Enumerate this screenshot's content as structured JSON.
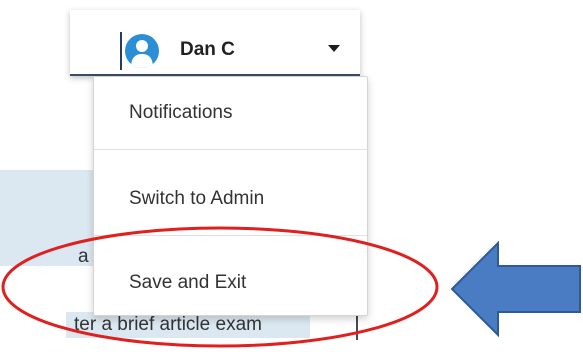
{
  "user_menu": {
    "user_name": "Dan C",
    "avatar_icon": "user-avatar-icon",
    "caret_icon": "caret-down-icon"
  },
  "dropdown": {
    "items": [
      {
        "label": "Notifications"
      },
      {
        "label": "Switch to Admin"
      },
      {
        "label": "Save and Exit"
      }
    ]
  },
  "background": {
    "fragment_1": "a",
    "fragment_2": "ter a brief article exam"
  },
  "colors": {
    "accent_blue": "#2c8fd6",
    "header_border": "#3c4a63",
    "highlight_ellipse": "#e0201f",
    "arrow_fill": "#4a7cc4",
    "arrow_stroke": "#2f5a96",
    "panel_bg": "#dbe8f1"
  },
  "annotations": {
    "highlight": "red-ellipse",
    "pointer": "blue-left-arrow"
  }
}
